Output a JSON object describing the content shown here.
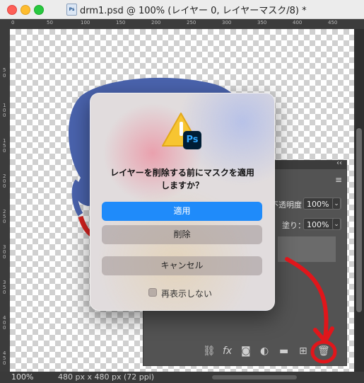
{
  "window": {
    "title": "drm1.psd @ 100% (レイヤー 0, レイヤーマスク/8) *",
    "file_icon": "ps-file-icon",
    "file_icon_text": "Ps"
  },
  "ruler": {
    "top_numbers": [
      "0",
      "50",
      "100",
      "150",
      "200",
      "250",
      "300",
      "350",
      "400",
      "450"
    ],
    "left_numbers": [
      "5",
      "0",
      "1 0 0",
      "1 5 0",
      "2 0 0",
      "2 5 0",
      "3 0 0",
      "3 5 0",
      "4 0 0",
      "4 5 0"
    ]
  },
  "status": {
    "zoom": "100%",
    "doc_size": "480 px x 480 px (72 ppi)"
  },
  "layers_panel": {
    "collapse": "‹‹",
    "menu": "≡",
    "opacity_label": "不透明度：",
    "opacity_value": "100%",
    "fill_label": "塗り：",
    "fill_value": "100%",
    "chevron": "⌄",
    "footer_icons": [
      "link-icon",
      "fx-icon",
      "mask-icon",
      "adjustment-icon",
      "folder-icon",
      "new-layer-icon",
      "trash-icon"
    ],
    "fx_text": "fx"
  },
  "dialog": {
    "app_badge": "Ps",
    "message_line1": "レイヤーを削除する前にマスクを適用",
    "message_line2": "しますか？",
    "apply_button": "適用",
    "delete_button": "削除",
    "cancel_button": "キャンセル",
    "dont_show_again": "再表示しない",
    "dont_show_checked": false
  },
  "colors": {
    "primary_button": "#1f8bfa",
    "annotation_red": "#e0161b",
    "blue_shape": "#4a63ad"
  }
}
